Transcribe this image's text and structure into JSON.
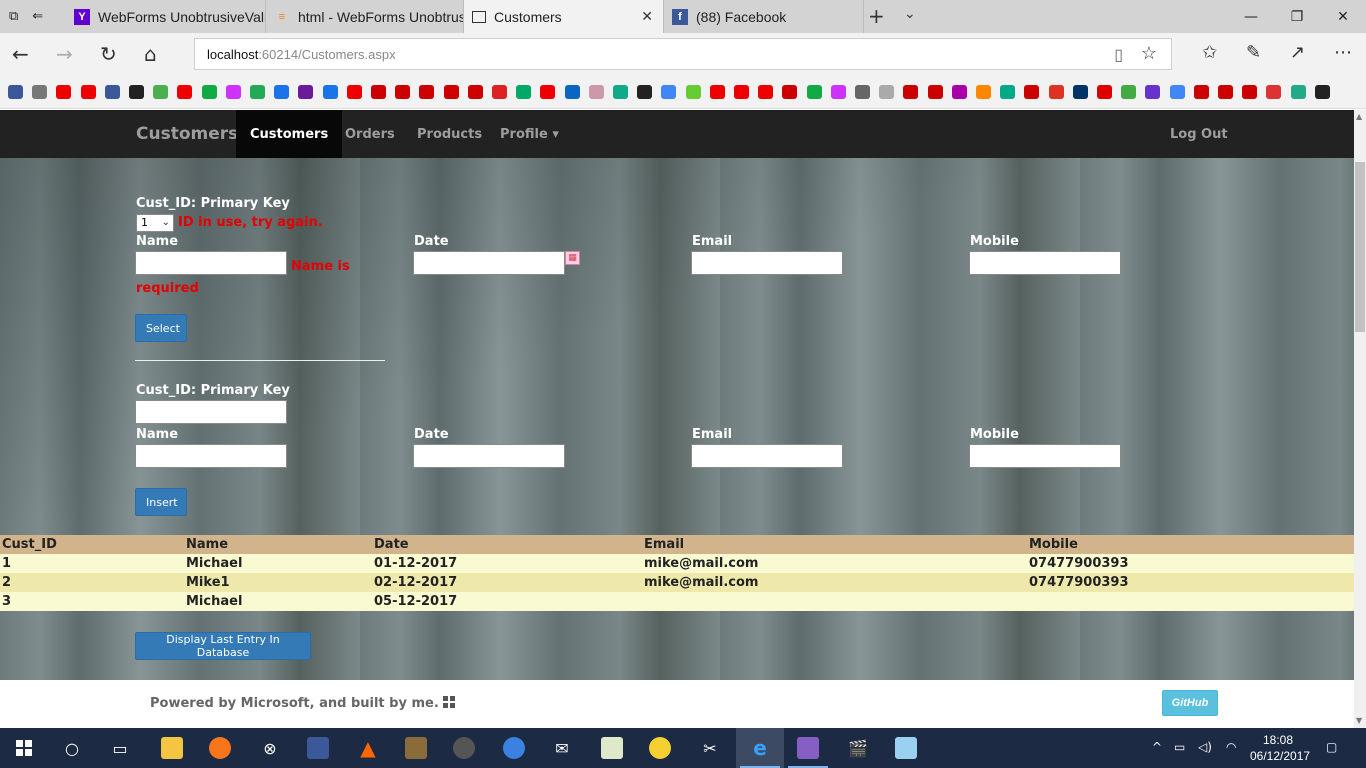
{
  "browser": {
    "tabs": [
      {
        "title": "WebForms UnobtrusiveValic",
        "favicon": "yahoo-icon",
        "color": "#6001d2"
      },
      {
        "title": "html - WebForms Unobtrusi",
        "favicon": "stackoverflow-icon",
        "color": "#f48024"
      },
      {
        "title": "Customers",
        "favicon": "page-icon",
        "color": "#333333"
      },
      {
        "title": "(88) Facebook",
        "favicon": "facebook-icon",
        "color": "#3b5998"
      }
    ],
    "url_host": "localhost",
    "url_rest": ":60214/Customers.aspx"
  },
  "site": {
    "brand": "Customers",
    "nav": [
      "Customers",
      "Orders",
      "Products",
      "Profile"
    ],
    "profile_caret": "▾",
    "logout": "Log Out"
  },
  "select_form": {
    "id_label": "Cust_ID: Primary Key",
    "id_value": "1",
    "id_error": "ID in use, try again.",
    "name_label": "Name",
    "name_error": "Name is required",
    "date_label": "Date",
    "email_label": "Email",
    "mobile_label": "Mobile",
    "button": "Select"
  },
  "insert_form": {
    "id_label": "Cust_ID: Primary Key",
    "name_label": "Name",
    "date_label": "Date",
    "email_label": "Email",
    "mobile_label": "Mobile",
    "button": "Insert"
  },
  "grid": {
    "headers": [
      "Cust_ID",
      "Name",
      "Date",
      "Email",
      "Mobile"
    ],
    "rows": [
      [
        "1",
        "Michael",
        "01-12-2017",
        "mike@mail.com",
        "07477900393"
      ],
      [
        "2",
        "Mike1",
        "02-12-2017",
        "mike@mail.com",
        "07477900393"
      ],
      [
        "3",
        "Michael",
        "05-12-2017",
        "",
        ""
      ]
    ]
  },
  "display_last_button": "Display Last Entry In Database",
  "footer": {
    "text": "Powered by Microsoft, and built by me.",
    "github": "GitHub"
  },
  "taskbar": {
    "time": "18:08",
    "date": "06/12/2017"
  },
  "colors": {
    "navbar": "#222222",
    "error": "#e40000",
    "button": "#337ab7",
    "grid_header": "#d2b48c",
    "grid_odd": "#fafad2",
    "grid_even": "#eee8aa",
    "github": "#5bc0de",
    "taskbar": "#1c2a43"
  }
}
